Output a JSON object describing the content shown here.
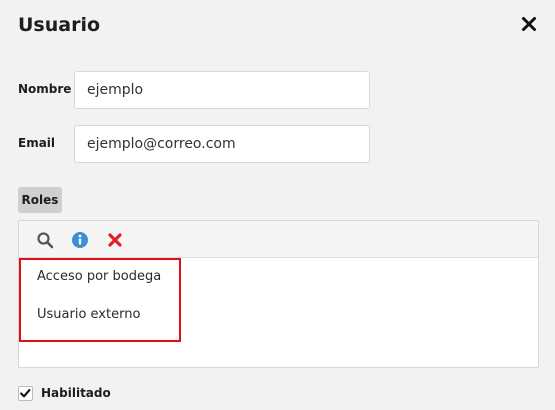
{
  "dialog": {
    "title": "Usuario"
  },
  "form": {
    "name_label": "Nombre",
    "name_value": "ejemplo",
    "email_label": "Email",
    "email_value": "ejemplo@correo.com"
  },
  "roles": {
    "section_label": "Roles",
    "toolbar": {
      "search_icon": "search-icon",
      "info_icon": "info-icon",
      "delete_icon": "delete-icon"
    },
    "items": [
      {
        "label": "Acceso por bodega"
      },
      {
        "label": "Usuario externo"
      }
    ]
  },
  "enabled": {
    "label": "Habilitado",
    "checked": true
  },
  "colors": {
    "background": "#f2f2f2",
    "info_blue": "#3a8fd6",
    "delete_red": "#e0202a",
    "highlight_red": "#e01010"
  }
}
